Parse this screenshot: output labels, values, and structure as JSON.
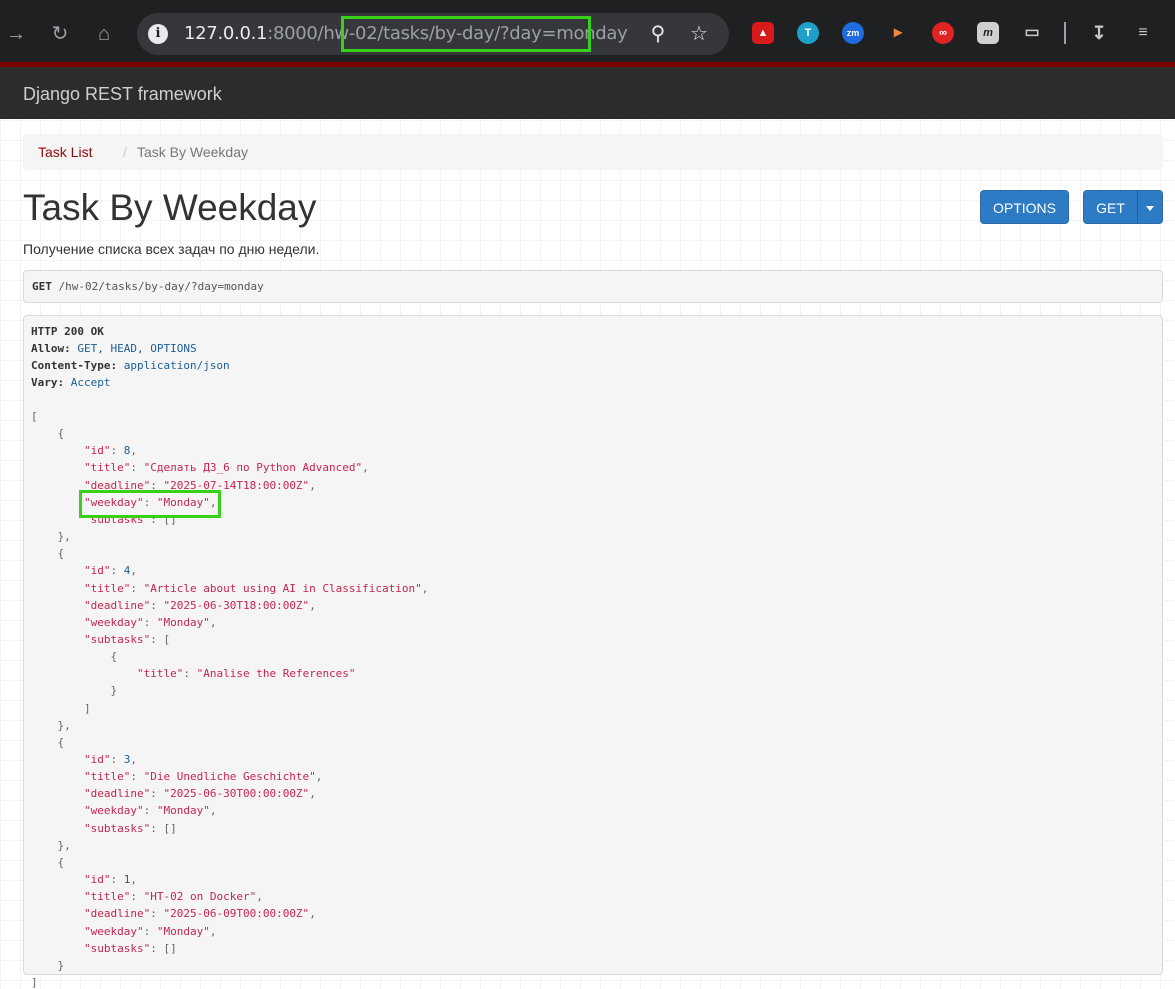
{
  "browser": {
    "url_host": "127.0.0.1",
    "url_rest": ":8000/hw-02/tasks/by-day/?day=monday",
    "extensions": [
      "mendeley-icon",
      "translate-icon",
      "zoom-icon",
      "megaphone-icon",
      "infinity-icon",
      "m-icon",
      "puzzle-icon"
    ],
    "zoom_icon_label": "zm",
    "t_icon_label": "T"
  },
  "navbar": {
    "brand": "Django REST framework"
  },
  "breadcrumb": {
    "link": "Task List",
    "separator": "/",
    "active": "Task By Weekday"
  },
  "page": {
    "title": "Task By Weekday",
    "description": "Получение списка всех задач по дню недели.",
    "options_button": "OPTIONS",
    "get_button": "GET"
  },
  "request": {
    "method": "GET",
    "path": "/hw-02/tasks/by-day/?day=monday"
  },
  "response": {
    "status": "HTTP 200 OK",
    "headers": [
      {
        "name": "Allow:",
        "value": "GET, HEAD, OPTIONS"
      },
      {
        "name": "Content-Type:",
        "value": "application/json"
      },
      {
        "name": "Vary:",
        "value": "Accept"
      }
    ],
    "tasks": [
      {
        "id": "8",
        "title": "Сделать ДЗ_6 по Python Advanced",
        "deadline": "2025-07-14T18:00:00Z",
        "weekday": "Monday",
        "subtasks": []
      },
      {
        "id": "4",
        "title": "Article about using AI in Classification",
        "deadline": "2025-06-30T18:00:00Z",
        "weekday": "Monday",
        "subtasks": [
          {
            "title": "Analise the References"
          }
        ]
      },
      {
        "id": "3",
        "title": "Die Unedliche Geschichte",
        "deadline": "2025-06-30T00:00:00Z",
        "weekday": "Monday",
        "subtasks": []
      },
      {
        "id": "1",
        "title": "HT-02 on Docker",
        "deadline": "2025-06-09T00:00:00Z",
        "weekday": "Monday",
        "subtasks": []
      }
    ]
  },
  "colors": {
    "accent": "#2c7bc4",
    "highlight": "#39d01a",
    "navbar": "#2c2c2c",
    "link": "#8e0a0a"
  }
}
